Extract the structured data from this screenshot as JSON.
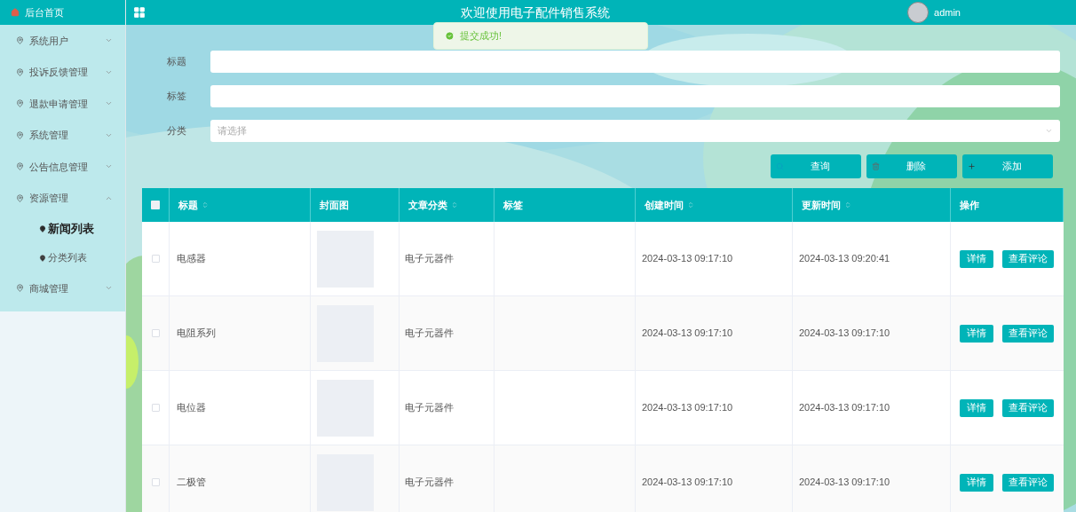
{
  "sidebar": {
    "home": "后台首页",
    "items": [
      {
        "label": "系统用户",
        "expanded": false
      },
      {
        "label": "投诉反馈管理",
        "expanded": false
      },
      {
        "label": "退款申请管理",
        "expanded": false
      },
      {
        "label": "系统管理",
        "expanded": false
      },
      {
        "label": "公告信息管理",
        "expanded": false
      },
      {
        "label": "资源管理",
        "expanded": true,
        "children": [
          {
            "label": "新闻列表",
            "selected": true
          },
          {
            "label": "分类列表",
            "selected": false
          }
        ]
      },
      {
        "label": "商城管理",
        "expanded": false
      }
    ]
  },
  "header": {
    "title": "欢迎使用电子配件销售系统",
    "user": "admin"
  },
  "toast": {
    "message": "提交成功!"
  },
  "filters": [
    {
      "label": "标题",
      "kind": "input"
    },
    {
      "label": "标签",
      "kind": "input"
    },
    {
      "label": "分类",
      "kind": "select",
      "placeholder": "请选择"
    }
  ],
  "actions": [
    {
      "label": "查询",
      "kind": "search"
    },
    {
      "label": "删除",
      "kind": "delete"
    },
    {
      "label": "添加",
      "kind": "add"
    }
  ],
  "table": {
    "all_checked": false,
    "columns": [
      {
        "label": "标题",
        "sortable": true
      },
      {
        "label": "封面图",
        "sortable": false
      },
      {
        "label": "文章分类",
        "sortable": true
      },
      {
        "label": "标签",
        "sortable": false
      },
      {
        "label": "创建时间",
        "sortable": true
      },
      {
        "label": "更新时间",
        "sortable": true
      },
      {
        "label": "操作",
        "sortable": false
      }
    ],
    "rows": [
      {
        "title": "电感器",
        "category": "电子元器件",
        "created": "2024-03-13 09:17:10",
        "updated": "2024-03-13 09:20:41",
        "checked": false,
        "actions": [
          "详情",
          "查看评论"
        ]
      },
      {
        "title": "电阻系列",
        "category": "电子元器件",
        "created": "2024-03-13 09:17:10",
        "updated": "2024-03-13 09:17:10",
        "checked": false,
        "actions": [
          "详情",
          "查看评论"
        ]
      },
      {
        "title": "电位器",
        "category": "电子元器件",
        "created": "2024-03-13 09:17:10",
        "updated": "2024-03-13 09:17:10",
        "checked": false,
        "actions": [
          "详情",
          "查看评论"
        ]
      },
      {
        "title": "二极管",
        "category": "电子元器件",
        "created": "2024-03-13 09:17:10",
        "updated": "2024-03-13 09:17:10",
        "checked": false,
        "actions": [
          "详情",
          "查看评论"
        ]
      }
    ]
  }
}
